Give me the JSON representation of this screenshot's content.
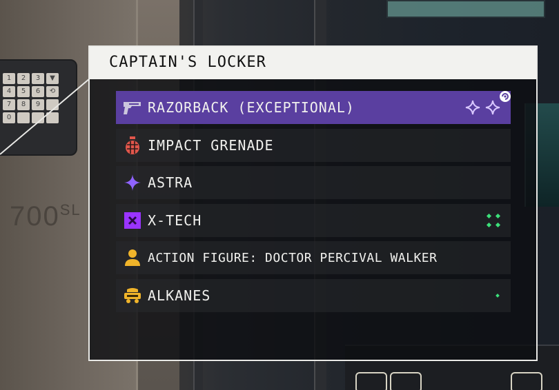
{
  "locker": {
    "title": "CAPTAIN'S LOCKER",
    "items": [
      {
        "label": "RAZORBACK (EXCEPTIONAL)",
        "icon": "pistol-icon",
        "selected": true,
        "tag_icon": "sparkle-quality-icon"
      },
      {
        "label": "IMPACT GRENADE",
        "icon": "grenade-icon",
        "selected": false
      },
      {
        "label": "ASTRA",
        "icon": "astra-star-icon",
        "selected": false
      },
      {
        "label": "X-TECH",
        "icon": "x-tech-icon",
        "selected": false,
        "tag_icon": "resource-dots-icon"
      },
      {
        "label": "ACTION FIGURE: DOCTOR PERCIVAL WALKER",
        "icon": "person-icon",
        "selected": false
      },
      {
        "label": "ALKANES",
        "icon": "resource-cart-icon",
        "selected": false,
        "tag_icon": "small-dot-icon"
      }
    ]
  },
  "background": {
    "model_text": "700",
    "model_suffix": "SL",
    "keypad_keys": [
      "1",
      "2",
      "3",
      "▼",
      "4",
      "5",
      "6",
      "⟲",
      "7",
      "8",
      "9",
      "",
      "0",
      "",
      "",
      ""
    ]
  },
  "colors": {
    "selected_row": "#5a3fa0",
    "sparkle": "#d9c8ff",
    "grenade": "#e0564b",
    "astra": "#8f63ff",
    "xtech": "#9a34ff",
    "figure": "#f0b42a",
    "alkanes": "#f0b42a",
    "dots": "#3ce07a"
  }
}
